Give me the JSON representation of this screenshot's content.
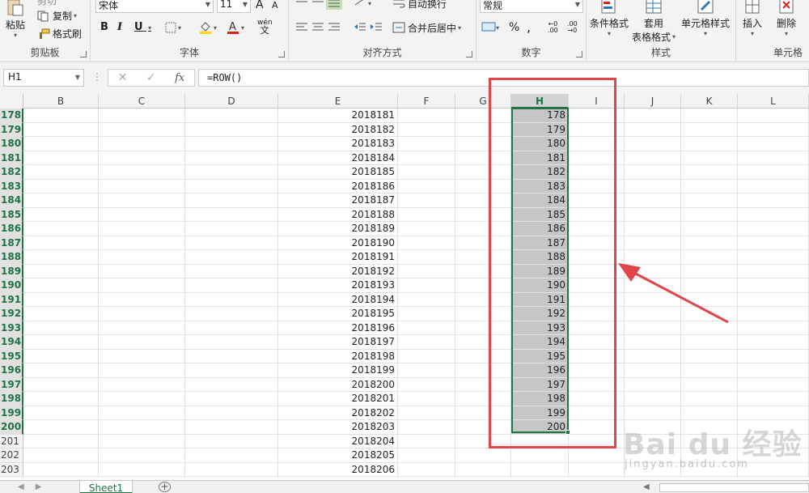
{
  "ribbon": {
    "clipboard": {
      "label": "剪贴板",
      "paste": "粘贴",
      "cut_partial": "剪切",
      "copy": "复制",
      "format_painter": "格式刷"
    },
    "font": {
      "label": "字体",
      "font_name": "宋体",
      "font_size": "11",
      "grow": "A",
      "shrink": "A",
      "bold": "B",
      "italic": "I",
      "underline": "U",
      "wen": "wén"
    },
    "alignment": {
      "label": "对齐方式",
      "wrap_text": "自动换行",
      "merge_center": "合并后居中"
    },
    "number": {
      "label": "数字",
      "format": "常规",
      "percent": "%",
      "comma": ","
    },
    "styles": {
      "label": "样式",
      "conditional": "条件格式",
      "table_format_1": "套用",
      "table_format_2": "表格格式",
      "cell_styles": "单元格样式"
    },
    "cells": {
      "label": "单元格",
      "insert": "插入",
      "delete": "删除"
    }
  },
  "formula_bar": {
    "name_box": "H1",
    "formula": "=ROW()",
    "fx": "fx"
  },
  "columns": [
    "B",
    "C",
    "D",
    "E",
    "F",
    "G",
    "H",
    "I",
    "J",
    "K",
    "L"
  ],
  "rows": [
    {
      "num": "178",
      "e": "2018181",
      "h": "178"
    },
    {
      "num": "179",
      "e": "2018182",
      "h": "179"
    },
    {
      "num": "180",
      "e": "2018183",
      "h": "180"
    },
    {
      "num": "181",
      "e": "2018184",
      "h": "181"
    },
    {
      "num": "182",
      "e": "2018185",
      "h": "182"
    },
    {
      "num": "183",
      "e": "2018186",
      "h": "183"
    },
    {
      "num": "184",
      "e": "2018187",
      "h": "184"
    },
    {
      "num": "185",
      "e": "2018188",
      "h": "185"
    },
    {
      "num": "186",
      "e": "2018189",
      "h": "186"
    },
    {
      "num": "187",
      "e": "2018190",
      "h": "187"
    },
    {
      "num": "188",
      "e": "2018191",
      "h": "188"
    },
    {
      "num": "189",
      "e": "2018192",
      "h": "189"
    },
    {
      "num": "190",
      "e": "2018193",
      "h": "190"
    },
    {
      "num": "191",
      "e": "2018194",
      "h": "191"
    },
    {
      "num": "192",
      "e": "2018195",
      "h": "192"
    },
    {
      "num": "193",
      "e": "2018196",
      "h": "193"
    },
    {
      "num": "194",
      "e": "2018197",
      "h": "194"
    },
    {
      "num": "195",
      "e": "2018198",
      "h": "195"
    },
    {
      "num": "196",
      "e": "2018199",
      "h": "196"
    },
    {
      "num": "197",
      "e": "2018200",
      "h": "197"
    },
    {
      "num": "198",
      "e": "2018201",
      "h": "198"
    },
    {
      "num": "199",
      "e": "2018202",
      "h": "199"
    },
    {
      "num": "200",
      "e": "2018203",
      "h": "200"
    },
    {
      "num": "201",
      "e": "2018204",
      "h": ""
    },
    {
      "num": "202",
      "e": "2018205",
      "h": ""
    },
    {
      "num": "203",
      "e": "2018206",
      "h": ""
    }
  ],
  "selected_rows": 23,
  "sheet_tab": "Sheet1",
  "colors": {
    "accent": "#217346",
    "annotation": "#e0454a"
  },
  "watermark": {
    "main": "Bai du 经验",
    "sub": "jingyan.baidu.com"
  }
}
